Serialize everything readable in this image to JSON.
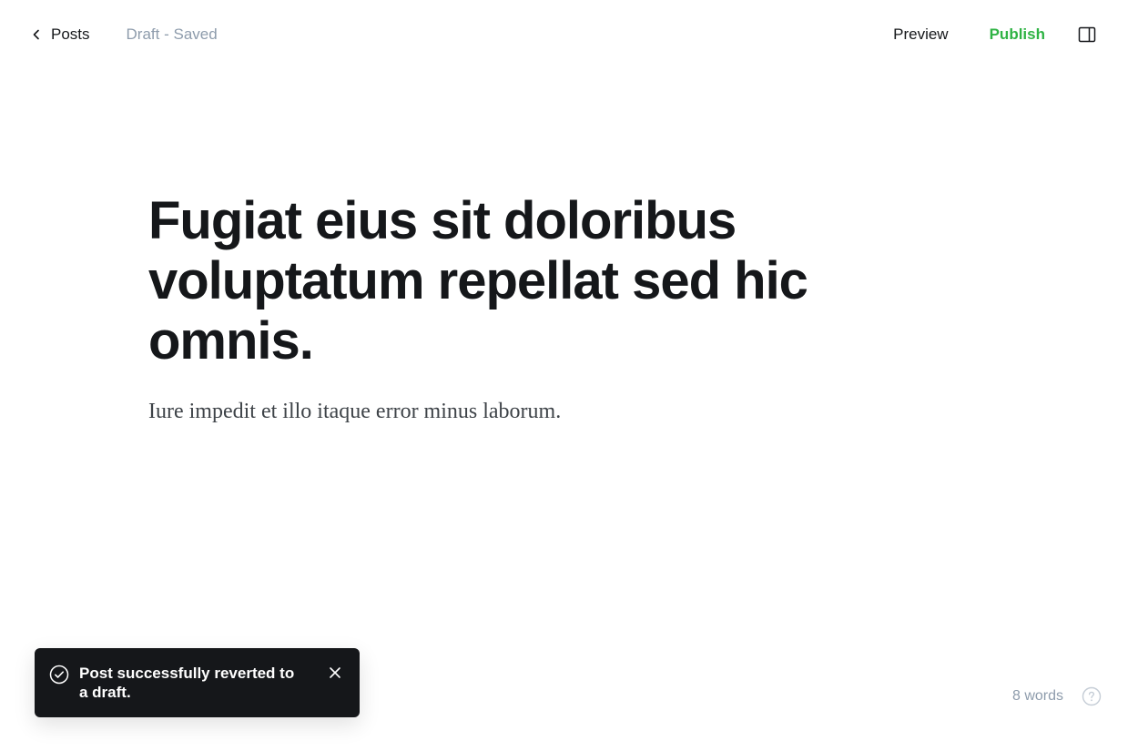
{
  "header": {
    "back_label": "Posts",
    "back_icon": "chevron-left-icon",
    "status": "Draft - Saved",
    "preview_label": "Preview",
    "publish_label": "Publish",
    "sidebar_icon": "sidebar-toggle-icon"
  },
  "editor": {
    "title": "Fugiat eius sit doloribus voluptatum repellat sed hic omnis.",
    "body": "Iure impedit et illo itaque error minus laborum."
  },
  "toast": {
    "icon": "check-circle-icon",
    "message": "Post successfully reverted to a draft.",
    "close_icon": "close-icon"
  },
  "footer": {
    "word_count": "8 words",
    "help_icon": "help-circle-icon"
  },
  "colors": {
    "publish": "#2fb344",
    "text": "#15171a",
    "muted": "#8e9cac",
    "toast_bg": "#15171a"
  }
}
